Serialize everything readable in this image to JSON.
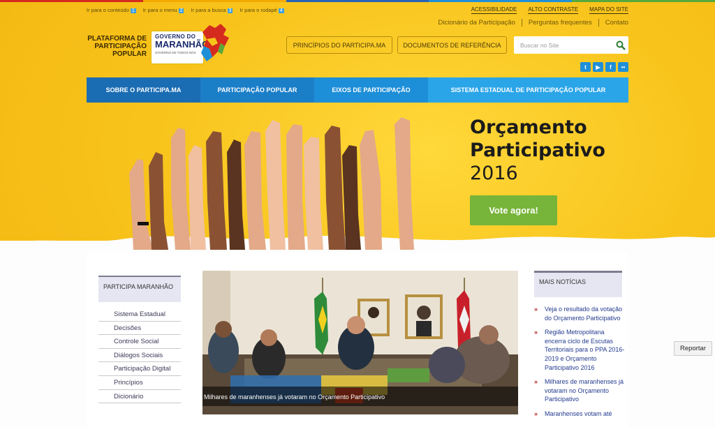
{
  "colors": {
    "strip": [
      "#d52b1e",
      "#f2a900",
      "#2a63b5",
      "#1f8fd8",
      "#58a93c"
    ],
    "nav": [
      "#1a6cb3",
      "#1b7fc8",
      "#1d8ed8",
      "#2aa5e8"
    ],
    "accent_button": "#77b43a"
  },
  "skip_links": [
    {
      "label": "Ir para o conteúdo",
      "key": "1"
    },
    {
      "label": "Ir para o menu",
      "key": "2"
    },
    {
      "label": "Ir para a busca",
      "key": "3"
    },
    {
      "label": "Ir para o rodapé",
      "key": "4"
    }
  ],
  "utility": {
    "links": [
      "ACESSIBILIDADE",
      "ALTO CONTRASTE",
      "MAPA DO SITE"
    ],
    "secondary": [
      "Dicionário da Participação",
      "Perguntas frequentes",
      "Contato"
    ]
  },
  "brand": {
    "line1": "PLATAFORMA DE",
    "line2": "PARTICIPAÇÃO",
    "line3": "POPULAR",
    "logo_top": "GOVERNO DO",
    "logo_main": "MARANHÃO",
    "logo_sub": "GOVERNO DE TODOS NÓS"
  },
  "header_buttons": {
    "principles": "PRINCÍPIOS DO PARTICIPA.MA",
    "documents": "DOCUMENTOS DE REFERÊNCIA"
  },
  "search": {
    "placeholder": "Buscar no Site",
    "icon": "search-icon"
  },
  "social": [
    "twitter-icon",
    "youtube-icon",
    "facebook-icon",
    "flickr-icon"
  ],
  "nav": [
    "SOBRE O PARTICIPA.MA",
    "PARTICIPAÇÃO POPULAR",
    "EIXOS DE PARTICIPAÇÃO",
    "SISTEMA ESTADUAL DE PARTICIPAÇÃO POPULAR"
  ],
  "hero": {
    "title_line1": "Orçamento",
    "title_line2": "Participativo",
    "year": "2016",
    "cta": "Vote agora!"
  },
  "sidebar": {
    "heading": "PARTICIPA MARANHÃO",
    "items": [
      "Sistema Estadual",
      "Decisões",
      "Controle Social",
      "Diálogos Sociais",
      "Participação Digital",
      "Princípios",
      "Dicionário"
    ]
  },
  "featured": {
    "caption": "Milhares de maranhenses já votaram no Orçamento Participativo"
  },
  "news": {
    "heading": "MAIS NOTÍCIAS",
    "items": [
      "Veja o resultado da votação do Orçamento Participativo",
      "Região Metropolitana encerra ciclo de Escutas Territoriais para o PPA 2016-2019 e Orçamento Participativo 2016",
      "Milhares de maranhenses já votaram no Orçamento Participativo",
      "Maranhenses votam até"
    ]
  },
  "report_button": "Reportar"
}
